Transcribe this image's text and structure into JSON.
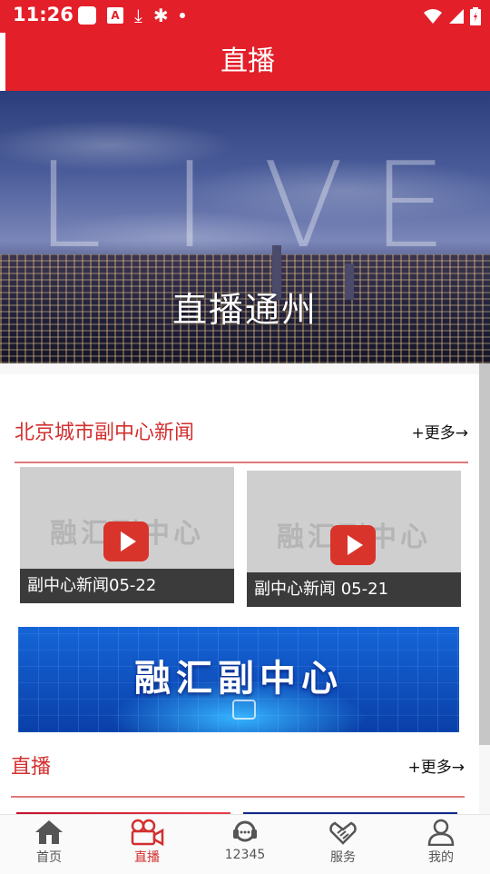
{
  "status": {
    "time": "11:26",
    "icons": [
      "square-icon",
      "a-icon",
      "download-icon",
      "bug-icon",
      "dot-icon",
      "wifi-icon",
      "signal-icon",
      "battery-icon"
    ]
  },
  "header": {
    "title": "直播"
  },
  "banner": {
    "overlay_text": [
      "L",
      "I",
      "V",
      "E"
    ],
    "caption": "直播通州"
  },
  "news_section": {
    "title": "北京城市副中心新闻",
    "more": "+更多→"
  },
  "videos": [
    {
      "caption": "副中心新闻05-22",
      "watermark": "融汇副中心"
    },
    {
      "caption": "副中心新闻 05-21",
      "watermark": "融汇副中心"
    }
  ],
  "promo": {
    "text": "融汇副中心"
  },
  "live_section": {
    "title": "直播",
    "more": "+更多→"
  },
  "tabs": [
    {
      "label": "首页",
      "icon": "home-icon",
      "active": false
    },
    {
      "label": "直播",
      "icon": "video-camera-icon",
      "active": true
    },
    {
      "label": "12345",
      "icon": "headset-icon",
      "active": false
    },
    {
      "label": "服务",
      "icon": "handshake-icon",
      "active": false
    },
    {
      "label": "我的",
      "icon": "user-icon",
      "active": false
    }
  ],
  "colors": {
    "brand_red": "#e31f2a",
    "section_red": "#d32f2f",
    "play_red": "#d9342b"
  }
}
